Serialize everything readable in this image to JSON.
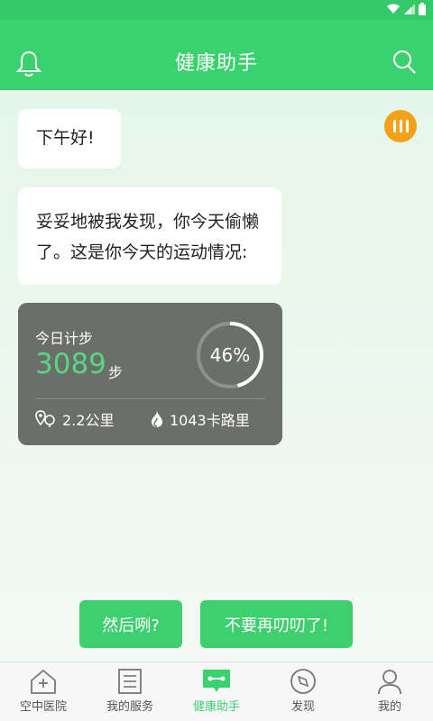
{
  "app": {
    "title": "健康助手"
  },
  "chat": {
    "greeting": "下午好!",
    "message_line1": "妥妥地被我发现，你今天偷懒",
    "message_line2": "了。这是你今天的运动情况:"
  },
  "steps": {
    "label": "今日计步",
    "value": "3089",
    "unit": "步",
    "percent_text": "46%",
    "percent": 0.46,
    "distance": "2.2公里",
    "calories": "1043卡路里"
  },
  "replies": [
    "然后咧?",
    "不要再叨叨了!"
  ],
  "tabs": [
    {
      "label": "空中医院",
      "icon": "house-plus-icon"
    },
    {
      "label": "我的服务",
      "icon": "list-icon"
    },
    {
      "label": "健康助手",
      "icon": "assistant-chat-icon"
    },
    {
      "label": "发现",
      "icon": "compass-icon"
    },
    {
      "label": "我的",
      "icon": "user-icon"
    }
  ],
  "colors": {
    "primary": "#3ad16f",
    "card": "#6c6e6b",
    "accent": "#f4a21a",
    "step_value": "#55d87f"
  }
}
